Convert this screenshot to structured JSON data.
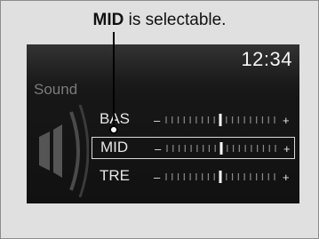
{
  "callout": {
    "bold": "MID",
    "rest": " is selectable."
  },
  "screen": {
    "clock": "12:34",
    "title": "Sound",
    "rows": [
      {
        "label": "BAS",
        "level": 0.5,
        "selected": false
      },
      {
        "label": "MID",
        "level": 0.5,
        "selected": true
      },
      {
        "label": "TRE",
        "level": 0.5,
        "selected": false
      }
    ],
    "slider": {
      "minus": "–",
      "plus": "+"
    }
  },
  "colors": {
    "screen_bg": "#171717",
    "text": "#e6e6e6",
    "tick": "#8a8a8a",
    "marker": "#ffffff"
  }
}
